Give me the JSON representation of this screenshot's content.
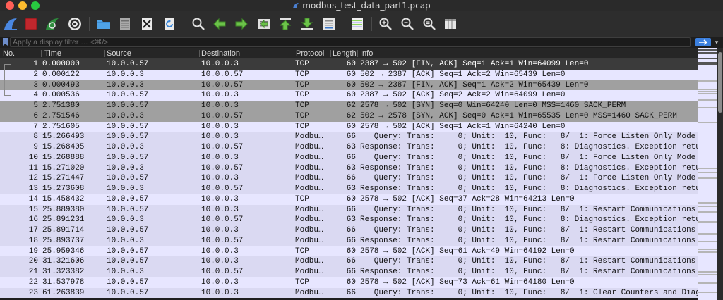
{
  "window": {
    "title": "modbus_test_data_part1.pcap"
  },
  "filter": {
    "placeholder": "Apply a display filter … <⌘/>",
    "dropdown_glyph": "▾"
  },
  "columns": {
    "no": "No.",
    "time": "Time",
    "source": "Source",
    "destination": "Destination",
    "protocol": "Protocol",
    "length": "Length",
    "info": "Info"
  },
  "packets": [
    {
      "no": "1",
      "time": "0.000000",
      "source": "10.0.0.57",
      "destination": "10.0.0.3",
      "protocol": "TCP",
      "length": "60",
      "info": "2387 → 502 [FIN, ACK] Seq=1 Ack=1 Win=64099 Len=0"
    },
    {
      "no": "2",
      "time": "0.000122",
      "source": "10.0.0.3",
      "destination": "10.0.0.57",
      "protocol": "TCP",
      "length": "60",
      "info": "502 → 2387 [ACK] Seq=1 Ack=2 Win=65439 Len=0"
    },
    {
      "no": "3",
      "time": "0.000493",
      "source": "10.0.0.3",
      "destination": "10.0.0.57",
      "protocol": "TCP",
      "length": "60",
      "info": "502 → 2387 [FIN, ACK] Seq=1 Ack=2 Win=65439 Len=0"
    },
    {
      "no": "4",
      "time": "0.000536",
      "source": "10.0.0.57",
      "destination": "10.0.0.3",
      "protocol": "TCP",
      "length": "60",
      "info": "2387 → 502 [ACK] Seq=2 Ack=2 Win=64099 Len=0"
    },
    {
      "no": "5",
      "time": "2.751380",
      "source": "10.0.0.57",
      "destination": "10.0.0.3",
      "protocol": "TCP",
      "length": "62",
      "info": "2578 → 502 [SYN] Seq=0 Win=64240 Len=0 MSS=1460 SACK_PERM"
    },
    {
      "no": "6",
      "time": "2.751546",
      "source": "10.0.0.3",
      "destination": "10.0.0.57",
      "protocol": "TCP",
      "length": "62",
      "info": "502 → 2578 [SYN, ACK] Seq=0 Ack=1 Win=65535 Len=0 MSS=1460 SACK_PERM"
    },
    {
      "no": "7",
      "time": "2.751605",
      "source": "10.0.0.57",
      "destination": "10.0.0.3",
      "protocol": "TCP",
      "length": "60",
      "info": "2578 → 502 [ACK] Seq=1 Ack=1 Win=64240 Len=0"
    },
    {
      "no": "8",
      "time": "15.266493",
      "source": "10.0.0.57",
      "destination": "10.0.0.3",
      "protocol": "Modbu…",
      "length": "66",
      "info": "   Query: Trans:     0; Unit:  10, Func:   8/  1: Force Listen Only Mode"
    },
    {
      "no": "9",
      "time": "15.268405",
      "source": "10.0.0.3",
      "destination": "10.0.0.57",
      "protocol": "Modbu…",
      "length": "63",
      "info": "Response: Trans:     0; Unit:  10, Func:   8: Diagnostics. Exception returned"
    },
    {
      "no": "10",
      "time": "15.268888",
      "source": "10.0.0.57",
      "destination": "10.0.0.3",
      "protocol": "Modbu…",
      "length": "66",
      "info": "   Query: Trans:     0; Unit:  10, Func:   8/  1: Force Listen Only Mode"
    },
    {
      "no": "11",
      "time": "15.271020",
      "source": "10.0.0.3",
      "destination": "10.0.0.57",
      "protocol": "Modbu…",
      "length": "63",
      "info": "Response: Trans:     0; Unit:  10, Func:   8: Diagnostics. Exception returned"
    },
    {
      "no": "12",
      "time": "15.271447",
      "source": "10.0.0.57",
      "destination": "10.0.0.3",
      "protocol": "Modbu…",
      "length": "66",
      "info": "   Query: Trans:     0; Unit:  10, Func:   8/  1: Force Listen Only Mode"
    },
    {
      "no": "13",
      "time": "15.273608",
      "source": "10.0.0.3",
      "destination": "10.0.0.57",
      "protocol": "Modbu…",
      "length": "63",
      "info": "Response: Trans:     0; Unit:  10, Func:   8: Diagnostics. Exception returned"
    },
    {
      "no": "14",
      "time": "15.458432",
      "source": "10.0.0.57",
      "destination": "10.0.0.3",
      "protocol": "TCP",
      "length": "60",
      "info": "2578 → 502 [ACK] Seq=37 Ack=28 Win=64213 Len=0"
    },
    {
      "no": "15",
      "time": "25.889380",
      "source": "10.0.0.57",
      "destination": "10.0.0.3",
      "protocol": "Modbu…",
      "length": "66",
      "info": "   Query: Trans:     0; Unit:  10, Func:   8/  1: Restart Communications Option"
    },
    {
      "no": "16",
      "time": "25.891231",
      "source": "10.0.0.3",
      "destination": "10.0.0.57",
      "protocol": "Modbu…",
      "length": "63",
      "info": "Response: Trans:     0; Unit:  10, Func:   8: Diagnostics. Exception returned"
    },
    {
      "no": "17",
      "time": "25.891714",
      "source": "10.0.0.57",
      "destination": "10.0.0.3",
      "protocol": "Modbu…",
      "length": "66",
      "info": "   Query: Trans:     0; Unit:  10, Func:   8/  1: Restart Communications Option"
    },
    {
      "no": "18",
      "time": "25.893737",
      "source": "10.0.0.3",
      "destination": "10.0.0.57",
      "protocol": "Modbu…",
      "length": "66",
      "info": "Response: Trans:     0; Unit:  10, Func:   8/  1: Restart Communications Option"
    },
    {
      "no": "19",
      "time": "25.959346",
      "source": "10.0.0.57",
      "destination": "10.0.0.3",
      "protocol": "TCP",
      "length": "60",
      "info": "2578 → 502 [ACK] Seq=61 Ack=49 Win=64192 Len=0"
    },
    {
      "no": "20",
      "time": "31.321606",
      "source": "10.0.0.57",
      "destination": "10.0.0.3",
      "protocol": "Modbu…",
      "length": "66",
      "info": "   Query: Trans:     0; Unit:  10, Func:   8/  1: Restart Communications Option"
    },
    {
      "no": "21",
      "time": "31.323382",
      "source": "10.0.0.3",
      "destination": "10.0.0.57",
      "protocol": "Modbu…",
      "length": "66",
      "info": "Response: Trans:     0; Unit:  10, Func:   8/  1: Restart Communications Option"
    },
    {
      "no": "22",
      "time": "31.537978",
      "source": "10.0.0.57",
      "destination": "10.0.0.3",
      "protocol": "TCP",
      "length": "60",
      "info": "2578 → 502 [ACK] Seq=73 Ack=61 Win=64180 Len=0"
    },
    {
      "no": "23",
      "time": "61.263839",
      "source": "10.0.0.57",
      "destination": "10.0.0.3",
      "protocol": "Modbu…",
      "length": "66",
      "info": "   Query: Trans:     0; Unit:  10, Func:   8/  1: Clear Counters and Diagnostic Registers"
    }
  ],
  "colors": {
    "tcp_row": "#e7e6ff",
    "modbus_row": "#dad9f2",
    "selected_row": "#3b3b3b",
    "flagged_row": "#a0a0a0",
    "accent": "#3b7fde"
  }
}
